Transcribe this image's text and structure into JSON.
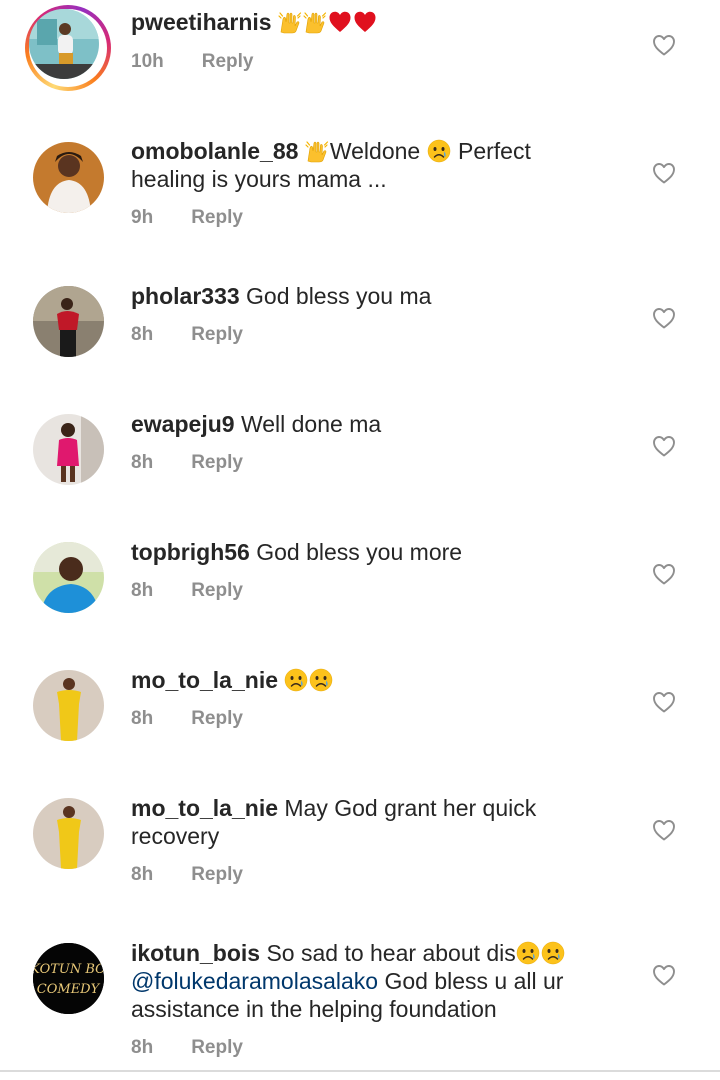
{
  "comments": [
    {
      "username": "pweetiharnis",
      "text_before": "",
      "emojis": [
        "raised-hands",
        "raised-hands",
        "red-heart",
        "red-heart"
      ],
      "text_after": "",
      "time": "10h",
      "reply_label": "Reply",
      "has_story": true
    },
    {
      "username": "omobolanle_88",
      "line1_text": "Weldone",
      "line1_after": "Perfect",
      "line2": "healing is yours mama ...",
      "time": "9h",
      "reply_label": "Reply"
    },
    {
      "username": "pholar333",
      "text": "God bless you ma",
      "time": "8h",
      "reply_label": "Reply"
    },
    {
      "username": "ewapeju9",
      "text": "Well done ma",
      "time": "8h",
      "reply_label": "Reply"
    },
    {
      "username": "topbrigh56",
      "text": "God bless you more",
      "time": "8h",
      "reply_label": "Reply"
    },
    {
      "username": "mo_to_la_nie",
      "text": "",
      "time": "8h",
      "reply_label": "Reply"
    },
    {
      "username": "mo_to_la_nie",
      "line1": "May God grant her quick",
      "line2": "recovery",
      "time": "8h",
      "reply_label": "Reply"
    },
    {
      "username": "ikotun_bois",
      "line1": "So sad to hear about dis",
      "mention": "@folukedaramolasalako",
      "line2_after": "God bless u all ur",
      "line3": "assistance in the helping foundation",
      "time": "8h",
      "reply_label": "Reply",
      "avatar_text_1": "KOTUN BO",
      "avatar_text_2": "COMEDY"
    }
  ],
  "colors": {
    "text": "#262626",
    "muted": "#8e8e8e",
    "mention": "#00376b",
    "heart_outline": "#8e8e8e"
  }
}
